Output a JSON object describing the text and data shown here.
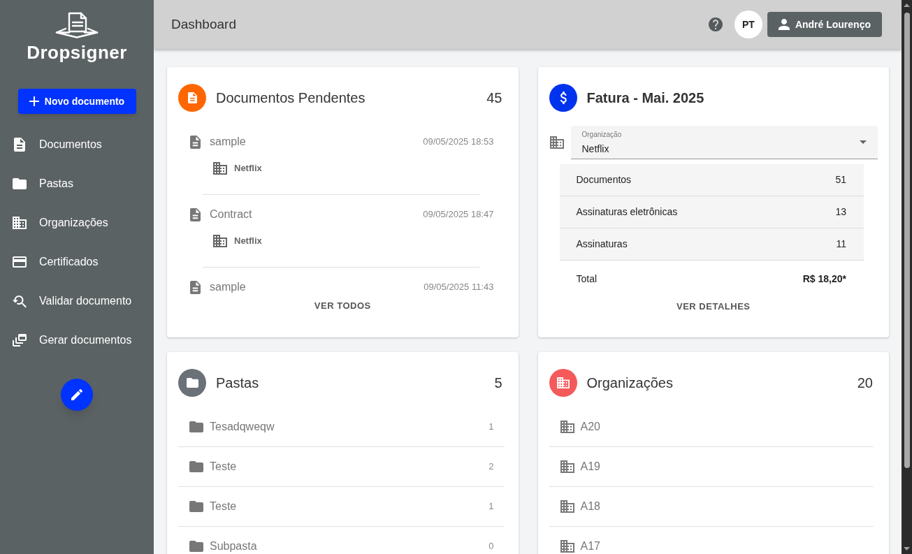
{
  "sidebar": {
    "logo_text": "Dropsigner",
    "new_document_button": "Novo documento",
    "nav": [
      {
        "label": "Documentos",
        "selected": false
      },
      {
        "label": "Pastas",
        "selected": false
      },
      {
        "label": "Organizações",
        "selected": false
      },
      {
        "label": "Certificados",
        "selected": false
      },
      {
        "label": "Validar documento",
        "selected": false
      },
      {
        "label": "Gerar documentos",
        "selected": false
      }
    ]
  },
  "header": {
    "title": "Dashboard",
    "avatar_initials": "PT",
    "user_button": "André Lourenço"
  },
  "pending_documents": {
    "title": "Documentos Pendentes",
    "count": "45",
    "items": [
      {
        "name": "sample",
        "date": "09/05/2025 18:53",
        "organization": "Netflix"
      },
      {
        "name": "Contract",
        "date": "09/05/2025 18:47",
        "organization": "Netflix"
      },
      {
        "name": "sample",
        "date": "09/05/2025 11:43"
      }
    ],
    "button": "VER TODOS"
  },
  "invoice": {
    "title": "Fatura - Mai. 2025",
    "organization_select": {
      "label": "Organização",
      "value": "Netflix"
    },
    "rows": [
      {
        "label": "Documentos",
        "value": "51"
      },
      {
        "label": "Assinaturas eletrônicas",
        "value": "13"
      },
      {
        "label": "Assinaturas",
        "value": "11"
      }
    ],
    "total": {
      "label": "Total",
      "value": "R$ 18,20*"
    },
    "button": "VER DETALHES"
  },
  "folders": {
    "title": "Pastas",
    "count": "5",
    "items": [
      {
        "name": "Tesadqweqw",
        "count": "1"
      },
      {
        "name": "Teste",
        "count": "2"
      },
      {
        "name": "Teste",
        "count": "1"
      },
      {
        "name": "Subpasta",
        "count": "0"
      }
    ]
  },
  "organizations": {
    "title": "Organizações",
    "count": "20",
    "items": [
      {
        "name": "A20"
      },
      {
        "name": "A19"
      },
      {
        "name": "A18"
      },
      {
        "name": "A17"
      }
    ]
  }
}
